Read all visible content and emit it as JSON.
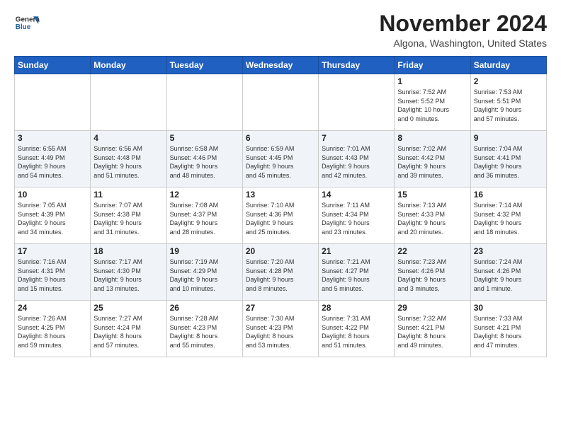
{
  "header": {
    "logo_general": "General",
    "logo_blue": "Blue",
    "month_year": "November 2024",
    "location": "Algona, Washington, United States"
  },
  "days_of_week": [
    "Sunday",
    "Monday",
    "Tuesday",
    "Wednesday",
    "Thursday",
    "Friday",
    "Saturday"
  ],
  "weeks": [
    [
      {
        "day": "",
        "info": ""
      },
      {
        "day": "",
        "info": ""
      },
      {
        "day": "",
        "info": ""
      },
      {
        "day": "",
        "info": ""
      },
      {
        "day": "",
        "info": ""
      },
      {
        "day": "1",
        "info": "Sunrise: 7:52 AM\nSunset: 5:52 PM\nDaylight: 10 hours\nand 0 minutes."
      },
      {
        "day": "2",
        "info": "Sunrise: 7:53 AM\nSunset: 5:51 PM\nDaylight: 9 hours\nand 57 minutes."
      }
    ],
    [
      {
        "day": "3",
        "info": "Sunrise: 6:55 AM\nSunset: 4:49 PM\nDaylight: 9 hours\nand 54 minutes."
      },
      {
        "day": "4",
        "info": "Sunrise: 6:56 AM\nSunset: 4:48 PM\nDaylight: 9 hours\nand 51 minutes."
      },
      {
        "day": "5",
        "info": "Sunrise: 6:58 AM\nSunset: 4:46 PM\nDaylight: 9 hours\nand 48 minutes."
      },
      {
        "day": "6",
        "info": "Sunrise: 6:59 AM\nSunset: 4:45 PM\nDaylight: 9 hours\nand 45 minutes."
      },
      {
        "day": "7",
        "info": "Sunrise: 7:01 AM\nSunset: 4:43 PM\nDaylight: 9 hours\nand 42 minutes."
      },
      {
        "day": "8",
        "info": "Sunrise: 7:02 AM\nSunset: 4:42 PM\nDaylight: 9 hours\nand 39 minutes."
      },
      {
        "day": "9",
        "info": "Sunrise: 7:04 AM\nSunset: 4:41 PM\nDaylight: 9 hours\nand 36 minutes."
      }
    ],
    [
      {
        "day": "10",
        "info": "Sunrise: 7:05 AM\nSunset: 4:39 PM\nDaylight: 9 hours\nand 34 minutes."
      },
      {
        "day": "11",
        "info": "Sunrise: 7:07 AM\nSunset: 4:38 PM\nDaylight: 9 hours\nand 31 minutes."
      },
      {
        "day": "12",
        "info": "Sunrise: 7:08 AM\nSunset: 4:37 PM\nDaylight: 9 hours\nand 28 minutes."
      },
      {
        "day": "13",
        "info": "Sunrise: 7:10 AM\nSunset: 4:36 PM\nDaylight: 9 hours\nand 25 minutes."
      },
      {
        "day": "14",
        "info": "Sunrise: 7:11 AM\nSunset: 4:34 PM\nDaylight: 9 hours\nand 23 minutes."
      },
      {
        "day": "15",
        "info": "Sunrise: 7:13 AM\nSunset: 4:33 PM\nDaylight: 9 hours\nand 20 minutes."
      },
      {
        "day": "16",
        "info": "Sunrise: 7:14 AM\nSunset: 4:32 PM\nDaylight: 9 hours\nand 18 minutes."
      }
    ],
    [
      {
        "day": "17",
        "info": "Sunrise: 7:16 AM\nSunset: 4:31 PM\nDaylight: 9 hours\nand 15 minutes."
      },
      {
        "day": "18",
        "info": "Sunrise: 7:17 AM\nSunset: 4:30 PM\nDaylight: 9 hours\nand 13 minutes."
      },
      {
        "day": "19",
        "info": "Sunrise: 7:19 AM\nSunset: 4:29 PM\nDaylight: 9 hours\nand 10 minutes."
      },
      {
        "day": "20",
        "info": "Sunrise: 7:20 AM\nSunset: 4:28 PM\nDaylight: 9 hours\nand 8 minutes."
      },
      {
        "day": "21",
        "info": "Sunrise: 7:21 AM\nSunset: 4:27 PM\nDaylight: 9 hours\nand 5 minutes."
      },
      {
        "day": "22",
        "info": "Sunrise: 7:23 AM\nSunset: 4:26 PM\nDaylight: 9 hours\nand 3 minutes."
      },
      {
        "day": "23",
        "info": "Sunrise: 7:24 AM\nSunset: 4:26 PM\nDaylight: 9 hours\nand 1 minute."
      }
    ],
    [
      {
        "day": "24",
        "info": "Sunrise: 7:26 AM\nSunset: 4:25 PM\nDaylight: 8 hours\nand 59 minutes."
      },
      {
        "day": "25",
        "info": "Sunrise: 7:27 AM\nSunset: 4:24 PM\nDaylight: 8 hours\nand 57 minutes."
      },
      {
        "day": "26",
        "info": "Sunrise: 7:28 AM\nSunset: 4:23 PM\nDaylight: 8 hours\nand 55 minutes."
      },
      {
        "day": "27",
        "info": "Sunrise: 7:30 AM\nSunset: 4:23 PM\nDaylight: 8 hours\nand 53 minutes."
      },
      {
        "day": "28",
        "info": "Sunrise: 7:31 AM\nSunset: 4:22 PM\nDaylight: 8 hours\nand 51 minutes."
      },
      {
        "day": "29",
        "info": "Sunrise: 7:32 AM\nSunset: 4:21 PM\nDaylight: 8 hours\nand 49 minutes."
      },
      {
        "day": "30",
        "info": "Sunrise: 7:33 AM\nSunset: 4:21 PM\nDaylight: 8 hours\nand 47 minutes."
      }
    ]
  ]
}
